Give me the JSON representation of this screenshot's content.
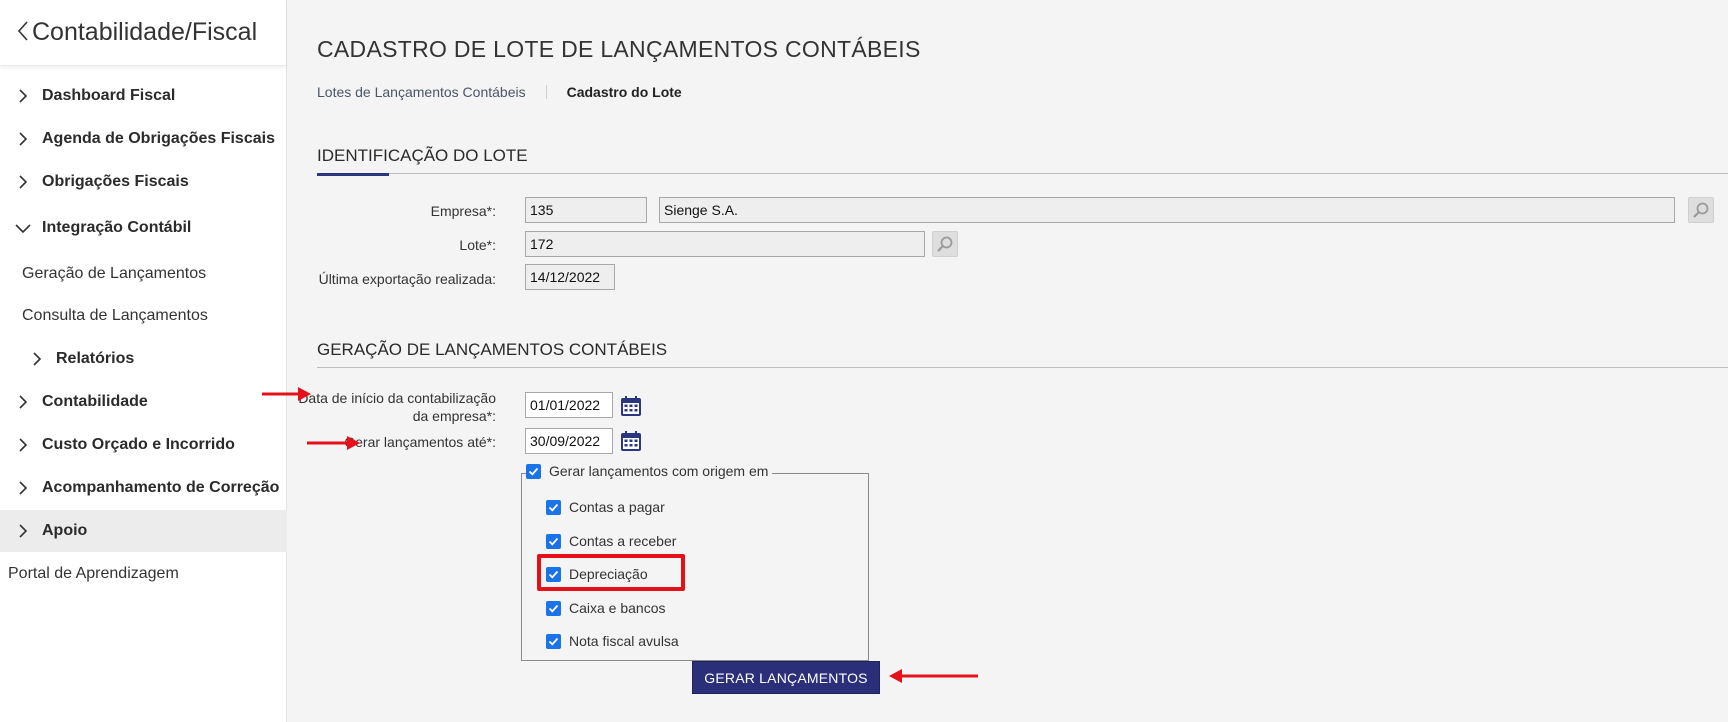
{
  "sidebar": {
    "back_icon": "chevron-left-icon",
    "title": "Contabilidade/Fiscal",
    "items": [
      {
        "label": "Dashboard Fiscal"
      },
      {
        "label": "Agenda de Obrigações Fiscais"
      },
      {
        "label": "Obrigações Fiscais"
      },
      {
        "label": "Integração Contábil",
        "expanded": true
      },
      {
        "label": "Geração de Lançamentos"
      },
      {
        "label": "Consulta de Lançamentos"
      },
      {
        "label": "Relatórios"
      },
      {
        "label": "Contabilidade"
      },
      {
        "label": "Custo Orçado e Incorrido"
      },
      {
        "label": "Acompanhamento de Correção"
      },
      {
        "label": "Apoio"
      },
      {
        "label": "Portal de Aprendizagem"
      }
    ]
  },
  "page": {
    "title": "CADASTRO DE LOTE DE LANÇAMENTOS CONTÁBEIS",
    "breadcrumb": {
      "link": "Lotes de Lançamentos Contábeis",
      "current": "Cadastro do Lote"
    }
  },
  "identificacao": {
    "title": "IDENTIFICAÇÃO DO LOTE",
    "empresa_label": "Empresa*:",
    "empresa_code": "135",
    "empresa_name": "Sienge S.A.",
    "lote_label": "Lote*:",
    "lote_value": "172",
    "ultima_label": "Última exportação realizada:",
    "ultima_value": "14/12/2022"
  },
  "geracao": {
    "title": "GERAÇÃO DE LANÇAMENTOS CONTÁBEIS",
    "data_inicio_label_1": "Data de início da contabilização",
    "data_inicio_label_2": "da empresa*:",
    "data_inicio_value": "01/01/2022",
    "gerar_ate_label": "Gerar lançamentos até*:",
    "gerar_ate_value": "30/09/2022",
    "origem_legend": "Gerar lançamentos com origem em",
    "origens": [
      {
        "label": "Contas a pagar",
        "checked": true
      },
      {
        "label": "Contas a receber",
        "checked": true
      },
      {
        "label": "Depreciação",
        "checked": true
      },
      {
        "label": "Caixa e bancos",
        "checked": true
      },
      {
        "label": "Nota fiscal avulsa",
        "checked": true
      }
    ],
    "button_label": "GERAR LANÇAMENTOS"
  },
  "colors": {
    "accent": "#2b2f7a",
    "checkbox": "#1a73e8",
    "annotation": "#e5101a"
  }
}
